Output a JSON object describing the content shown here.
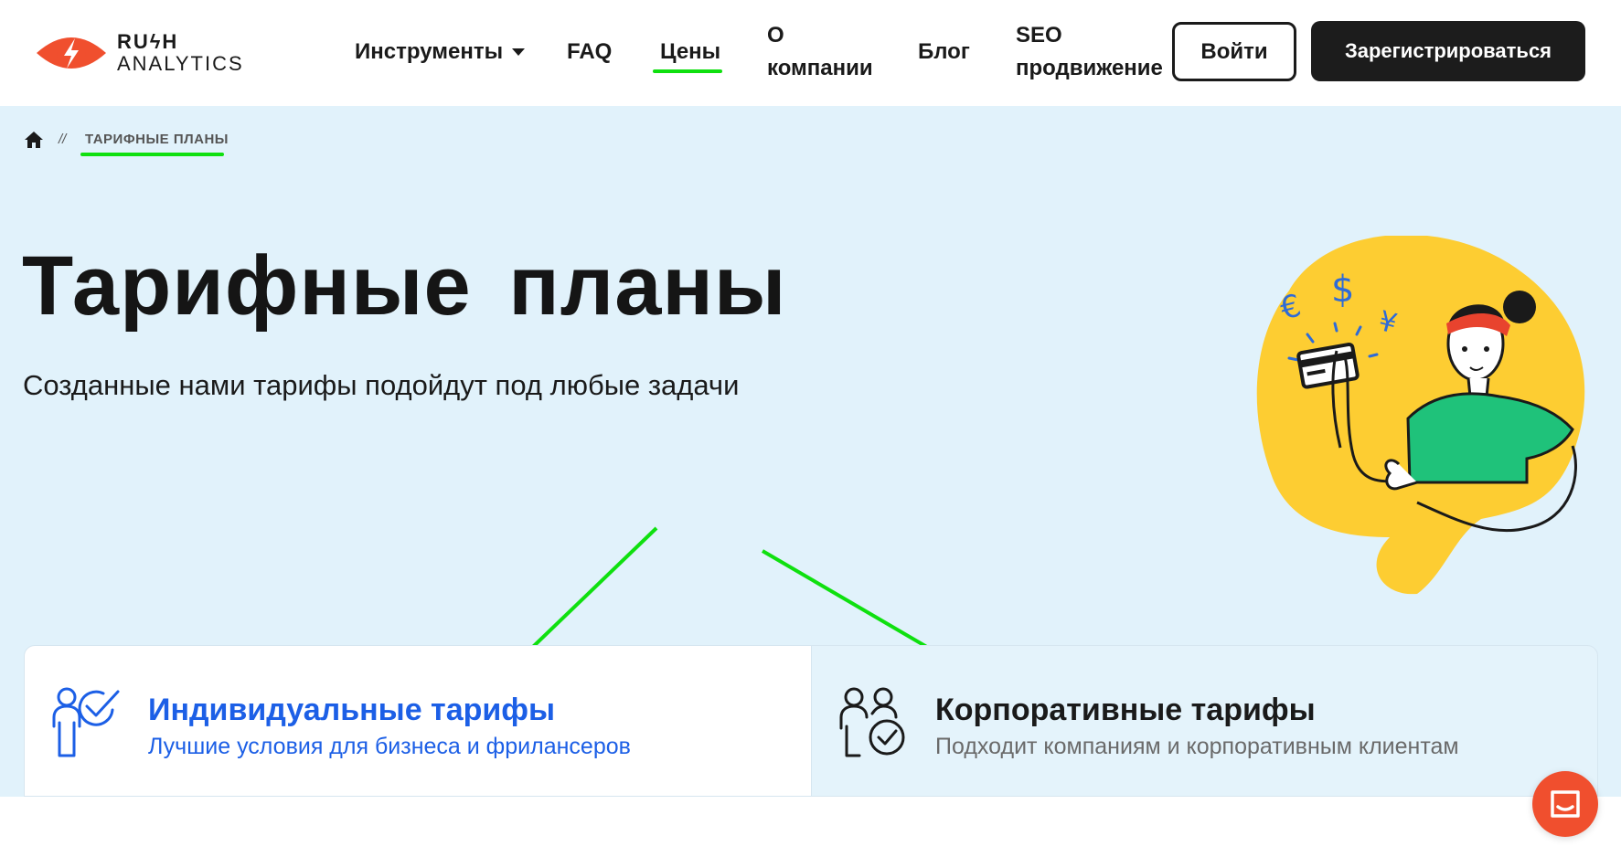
{
  "brand": {
    "line1": "RUϟH",
    "line2": "ANALYTICS",
    "accent": "#f04f2e"
  },
  "nav": {
    "tools": "Инструменты",
    "faq": "FAQ",
    "prices": "Цены",
    "about_l1": "О",
    "about_l2": "компании",
    "blog": "Блог",
    "seo_l1": "SEO",
    "seo_l2": "продвижение",
    "login": "Войти",
    "register": "Зарегистрироваться"
  },
  "breadcrumb": {
    "separator": "//",
    "current": "ТАРИФНЫЕ ПЛАНЫ"
  },
  "hero": {
    "title": "Тарифные планы",
    "subtitle": "Созданные нами тарифы подойдут под любые задачи"
  },
  "tabs": [
    {
      "title": "Индивидуальные тарифы",
      "description": "Лучшие условия для бизнеса и фрилансеров",
      "active": true
    },
    {
      "title": "Корпоративные тарифы",
      "description": "Подходит компаниям и корпоративным клиентам",
      "active": false
    }
  ],
  "colors": {
    "active_blue": "#1c5fe6",
    "hero_bg": "#e1f2fb",
    "highlight_green": "#0fe00f",
    "blob_yellow": "#fdcd32",
    "shirt_green": "#1fc27a"
  }
}
